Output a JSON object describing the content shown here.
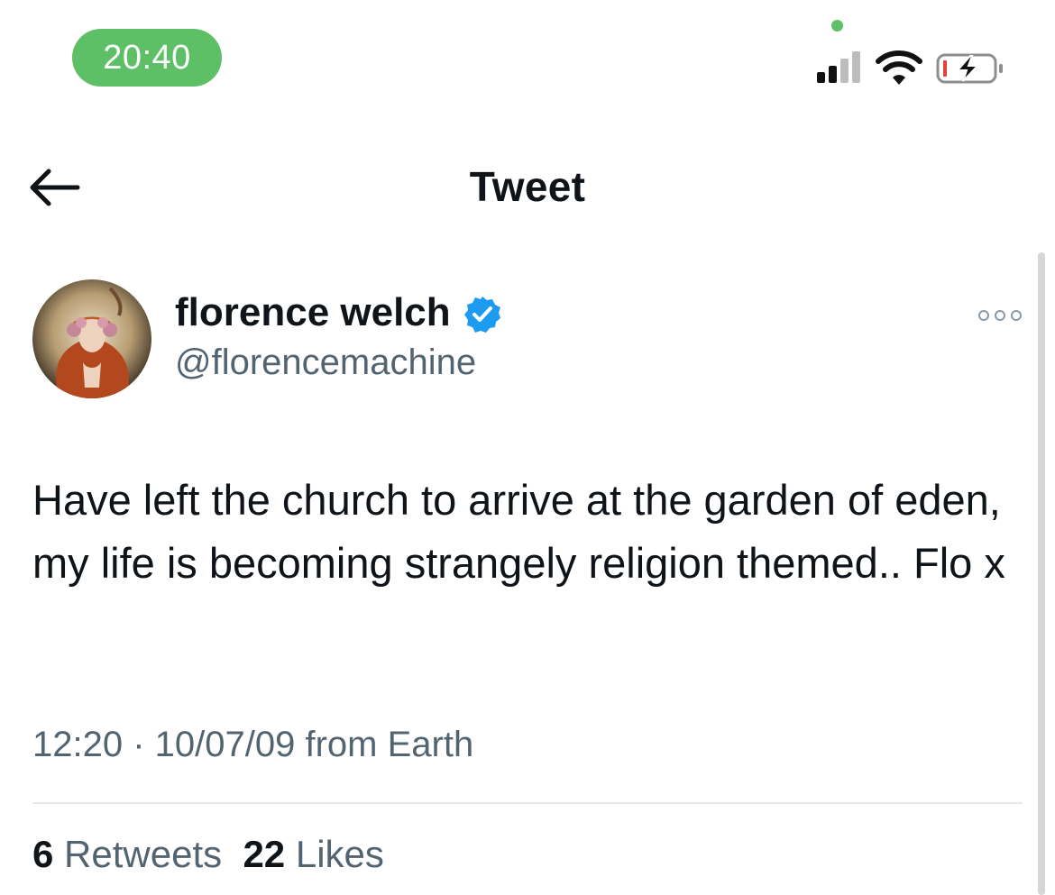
{
  "status_bar": {
    "time": "20:40",
    "icons": [
      "signal-icon",
      "wifi-icon",
      "battery-charging-icon"
    ],
    "colors": {
      "time_pill": "#5dbf66",
      "privacy_dot": "#5dbf66",
      "battery_low": "#e0443e"
    }
  },
  "nav": {
    "title": "Tweet",
    "back_icon": "arrow-left-icon"
  },
  "tweet": {
    "author": {
      "display_name": "florence welch",
      "handle": "@florencemachine",
      "verified_icon": "verified-badge-icon",
      "verified_color": "#1d9bf0"
    },
    "more_icon": "more-horizontal-icon",
    "text": "Have left the church to arrive at the garden of eden, my life is becoming strangely religion themed.. Flo x",
    "time": "12:20",
    "separator": " · ",
    "date": "10/07/09",
    "source": " from Earth",
    "stats": {
      "retweets_count": "6",
      "retweets_label": "Retweets",
      "likes_count": "22",
      "likes_label": "Likes"
    }
  }
}
